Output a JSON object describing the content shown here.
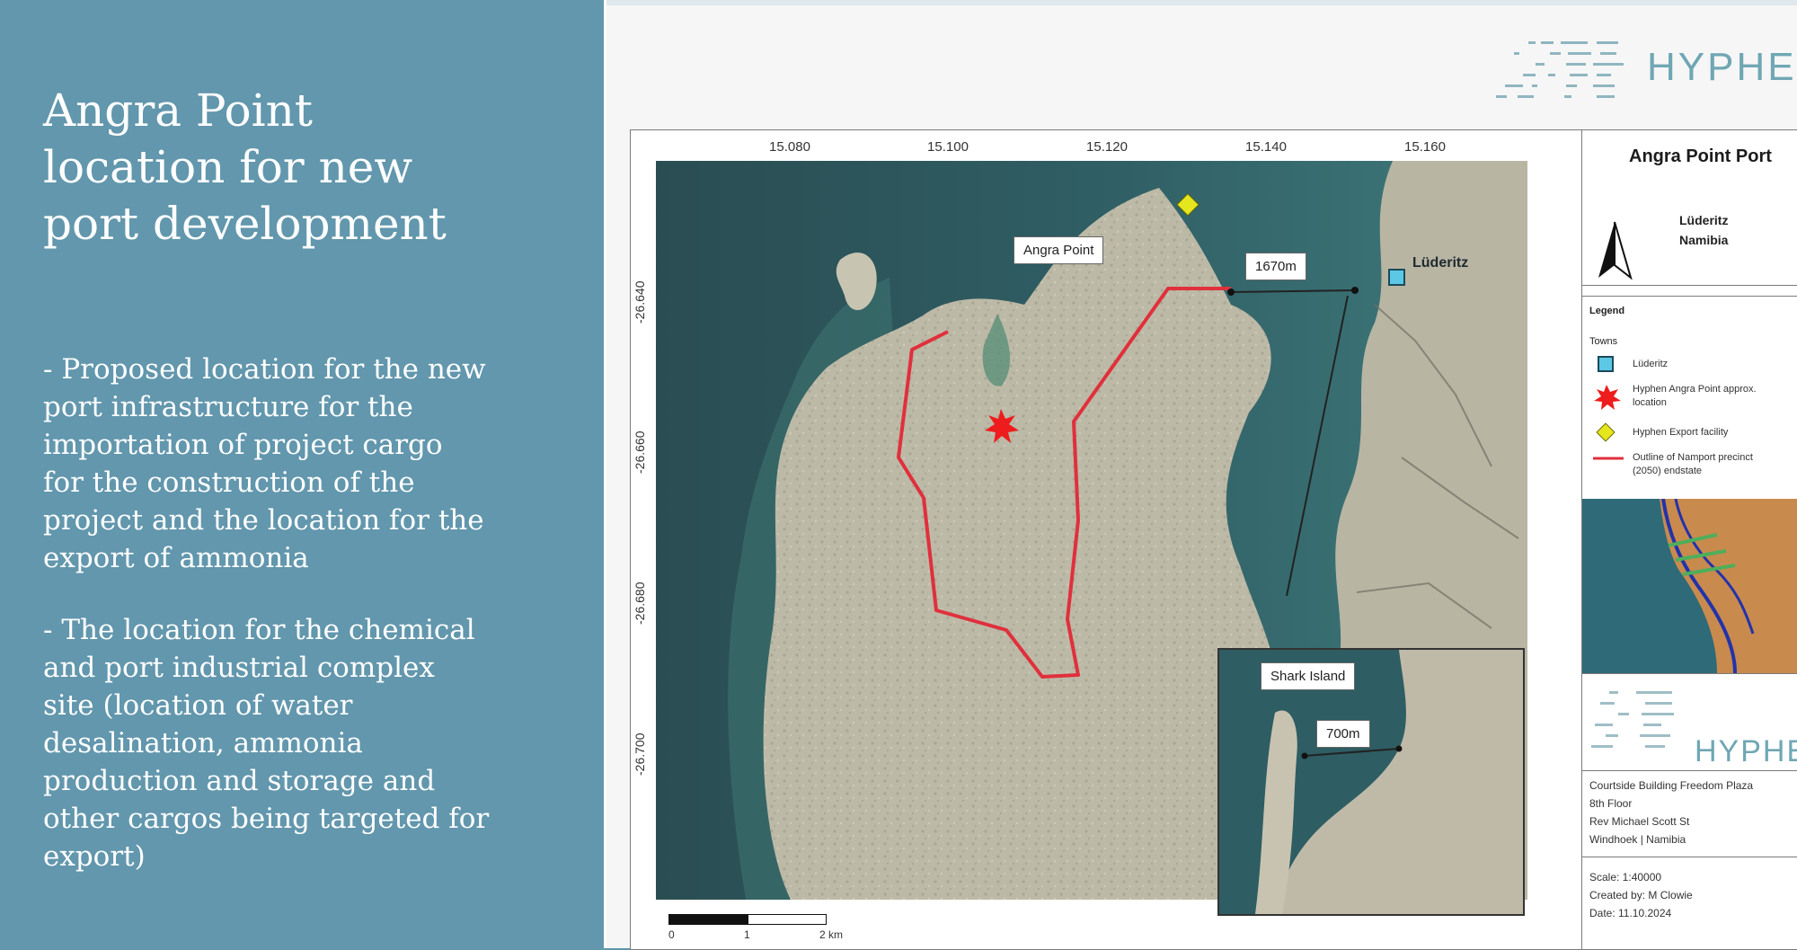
{
  "slide": {
    "title_lines": [
      "Angra Point",
      "location for new",
      "port development"
    ],
    "bullet_1_lines": [
      "- Proposed location for the new",
      "port infrastructure for the",
      "importation of project cargo",
      "for the construction of the",
      "project and the location for the",
      "export of ammonia"
    ],
    "bullet_2_lines": [
      "- The location for the chemical",
      "and port industrial complex",
      "site (location of water",
      "desalination, ammonia",
      "production and storage and",
      "other cargos being targeted for",
      "export)"
    ]
  },
  "brand": {
    "top_logo_text": "HYPHEN",
    "panel_logo_text": "HYPHEN",
    "logo_color": "#6fa7b3"
  },
  "map": {
    "x_ticks": [
      "15.080",
      "15.100",
      "15.120",
      "15.140",
      "15.160"
    ],
    "y_ticks": [
      "-26.640",
      "-26.660",
      "-26.680",
      "-26.700"
    ],
    "labels": {
      "angra_point": "Angra Point",
      "distance_main": "1670m",
      "luderitz": "Lüderitz",
      "shark_island": "Shark Island",
      "distance_inset": "700m"
    },
    "scalebar": {
      "labels": [
        "0",
        "1",
        "2 km"
      ]
    },
    "colors": {
      "sea": "#2c5a60",
      "land": "#bcb8a6",
      "outline": "#e0303c",
      "facility": "#e6e61e",
      "town": "#5cc8e6",
      "location": "#ee1c1c"
    }
  },
  "panel": {
    "title": "Angra Point Port",
    "place_line_1": "Lüderitz",
    "place_line_2": "Namibia",
    "legend": {
      "title": "Legend",
      "subtitle": "Towns",
      "items": [
        {
          "symbol": "town-square",
          "lines": [
            "Lüderitz"
          ]
        },
        {
          "symbol": "location-burst",
          "lines": [
            "Hyphen Angra Point approx.",
            "location"
          ]
        },
        {
          "symbol": "facility-diamond",
          "lines": [
            "Hyphen Export facility"
          ]
        },
        {
          "symbol": "outline-line",
          "lines": [
            "Outline of Namport precinct",
            "(2050) endstate"
          ]
        }
      ]
    },
    "address_lines": [
      "Courtside Building Freedom Plaza",
      "8th Floor",
      "Rev Michael Scott St",
      "Windhoek | Namibia"
    ],
    "meta_lines": [
      "Scale: 1:40000",
      "Created by: M Clowie",
      "Date: 11.10.2024"
    ]
  }
}
